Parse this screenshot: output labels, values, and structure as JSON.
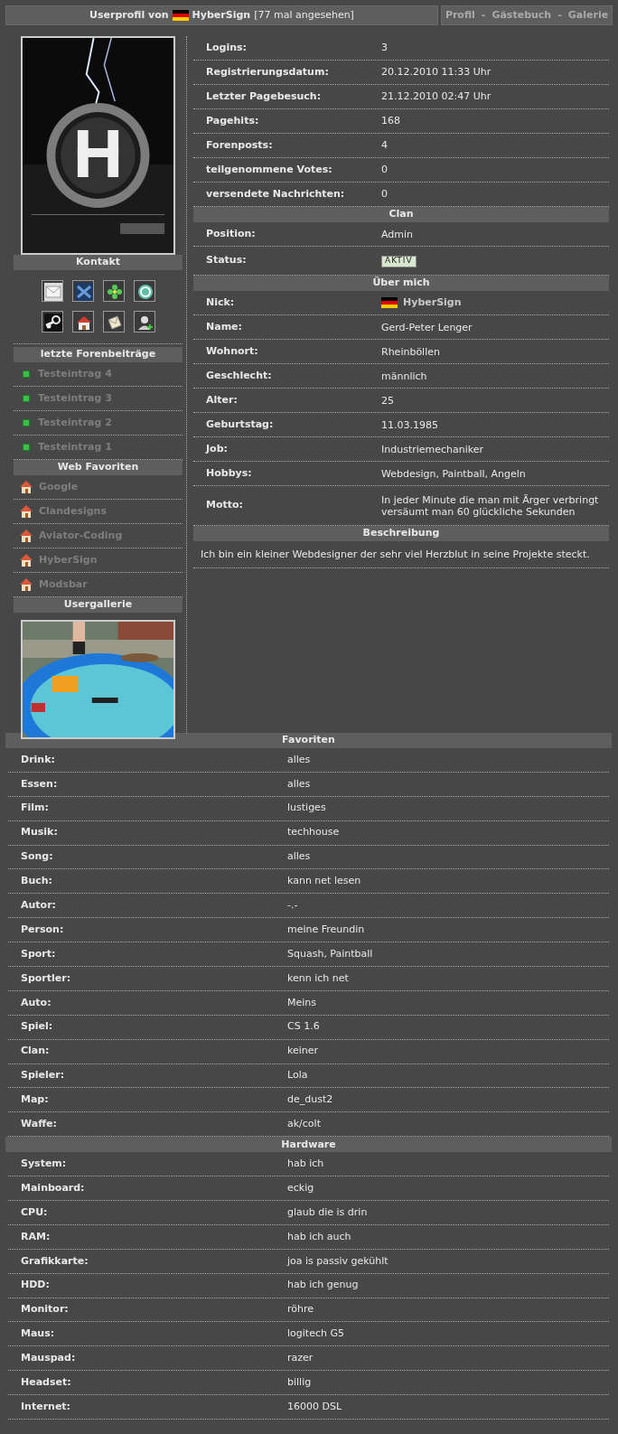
{
  "header": {
    "title_prefix": "Userprofil von",
    "nick": "HyberSign",
    "views": "[77 mal angesehen]",
    "nav": [
      {
        "label": "Profil"
      },
      {
        "label": "Gästebuch"
      },
      {
        "label": "Galerie"
      }
    ],
    "separator": "-"
  },
  "sidebar": {
    "contact": {
      "title": "Kontakt",
      "icons": [
        {
          "kind": "mail"
        },
        {
          "kind": "xfire"
        },
        {
          "kind": "icq"
        },
        {
          "kind": "skype"
        },
        {
          "kind": "steam"
        },
        {
          "kind": "home"
        },
        {
          "kind": "message"
        },
        {
          "kind": "add_buddy"
        }
      ]
    },
    "forum_posts": {
      "title": "letzte Forenbeiträge",
      "items": [
        "Testeintrag 4",
        "Testeintrag 3",
        "Testeintrag 2",
        "Testeintrag 1"
      ]
    },
    "web_favorites": {
      "title": "Web Favoriten",
      "items": [
        "Google",
        "Clandesigns",
        "Aviator-Coding",
        "HyberSign",
        "Modsbar"
      ]
    },
    "gallery": {
      "title": "Usergallerie"
    }
  },
  "stats": [
    {
      "label": "Logins:",
      "value": "3"
    },
    {
      "label": "Registrierungsdatum:",
      "value": "20.12.2010 11:33 Uhr"
    },
    {
      "label": "Letzter Pagebesuch:",
      "value": "21.12.2010 02:47 Uhr"
    },
    {
      "label": "Pagehits:",
      "value": "168"
    },
    {
      "label": "Forenposts:",
      "value": "4"
    },
    {
      "label": "teilgenommene Votes:",
      "value": "0"
    },
    {
      "label": "versendete Nachrichten:",
      "value": "0"
    }
  ],
  "clan": {
    "title": "Clan",
    "rows": [
      {
        "kind": "text",
        "label": "Position:",
        "value": "Admin"
      },
      {
        "kind": "badge",
        "label": "Status:",
        "value": "AKTIV"
      }
    ]
  },
  "about": {
    "title": "Über mich",
    "rows": [
      {
        "kind": "nick",
        "label": "Nick:",
        "value": "HyberSign"
      },
      {
        "kind": "text",
        "label": "Name:",
        "value": "Gerd-Peter Lenger"
      },
      {
        "kind": "text",
        "label": "Wohnort:",
        "value": "Rheinböllen"
      },
      {
        "kind": "text",
        "label": "Geschlecht:",
        "value": "männlich"
      },
      {
        "kind": "text",
        "label": "Alter:",
        "value": "25"
      },
      {
        "kind": "text",
        "label": "Geburtstag:",
        "value": "11.03.1985"
      },
      {
        "kind": "text",
        "label": "Job:",
        "value": "Industriemechaniker"
      },
      {
        "kind": "text",
        "label": "Hobbys:",
        "value": "Webdesign, Paintball, Angeln"
      },
      {
        "kind": "text",
        "label": "Motto:",
        "value": "In jeder Minute die man mit Ärger verbringt versäumt man 60 glückliche Sekunden"
      }
    ]
  },
  "description": {
    "title": "Beschreibung",
    "text": "Ich bin ein kleiner Webdesigner der sehr viel Herzblut in seine Projekte steckt."
  },
  "favorites": {
    "title": "Favoriten",
    "rows": [
      {
        "label": "Drink:",
        "value": "alles"
      },
      {
        "label": "Essen:",
        "value": "alles"
      },
      {
        "label": "Film:",
        "value": "lustiges"
      },
      {
        "label": "Musik:",
        "value": "techhouse"
      },
      {
        "label": "Song:",
        "value": "alles"
      },
      {
        "label": "Buch:",
        "value": "kann net lesen"
      },
      {
        "label": "Autor:",
        "value": "-.-"
      },
      {
        "label": "Person:",
        "value": "meine Freundin"
      },
      {
        "label": "Sport:",
        "value": "Squash, Paintball"
      },
      {
        "label": "Sportler:",
        "value": "kenn ich net"
      },
      {
        "label": "Auto:",
        "value": "Meins"
      },
      {
        "label": "Spiel:",
        "value": "CS 1.6"
      },
      {
        "label": "Clan:",
        "value": "keiner"
      },
      {
        "label": "Spieler:",
        "value": "Lola"
      },
      {
        "label": "Map:",
        "value": "de_dust2"
      },
      {
        "label": "Waffe:",
        "value": "ak/colt"
      }
    ]
  },
  "hardware": {
    "title": "Hardware",
    "rows": [
      {
        "label": "System:",
        "value": "hab ich"
      },
      {
        "label": "Mainboard:",
        "value": "eckig"
      },
      {
        "label": "CPU:",
        "value": "glaub die is drin"
      },
      {
        "label": "RAM:",
        "value": "hab ich auch"
      },
      {
        "label": "Grafikkarte:",
        "value": "joa is passiv gekühlt"
      },
      {
        "label": "HDD:",
        "value": "hab ich genug"
      },
      {
        "label": "Monitor:",
        "value": "röhre"
      },
      {
        "label": "Maus:",
        "value": "logitech G5"
      },
      {
        "label": "Mauspad:",
        "value": "razer"
      },
      {
        "label": "Headset:",
        "value": "billig"
      },
      {
        "label": "Internet:",
        "value": "16000 DSL"
      }
    ]
  }
}
